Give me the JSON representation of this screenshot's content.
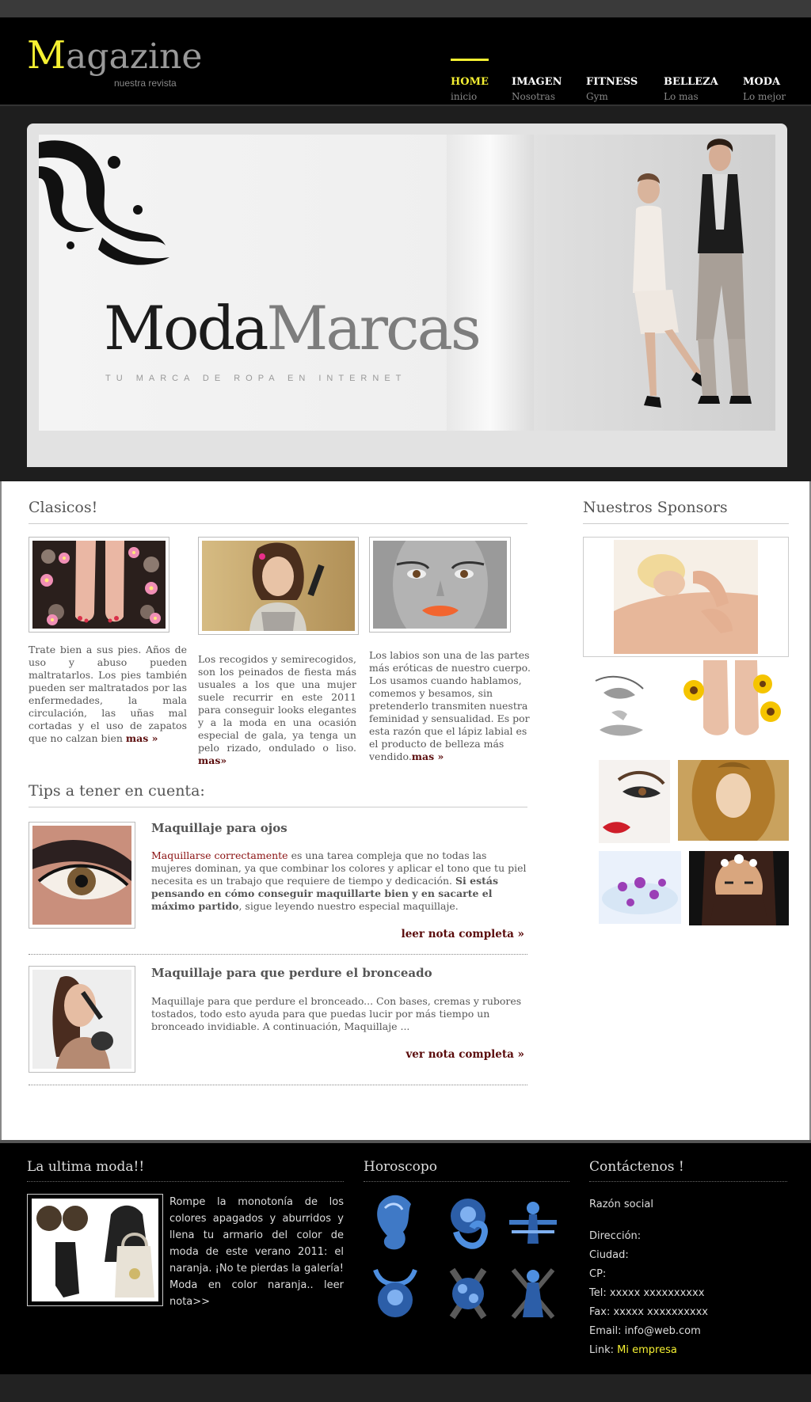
{
  "header": {
    "logo_first": "M",
    "logo_rest": "agazine",
    "logo_sub": "nuestra revista",
    "nav": [
      {
        "label": "HOME",
        "sub": "inicio",
        "active": true
      },
      {
        "label": "IMAGEN",
        "sub": "Nosotras"
      },
      {
        "label": "FITNESS",
        "sub": "Gym"
      },
      {
        "label": "BELLEZA",
        "sub": "Lo mas"
      },
      {
        "label": "MODA",
        "sub": "Lo mejor"
      }
    ]
  },
  "hero": {
    "brand_a": "Moda",
    "brand_b": "Marcas",
    "tagline": "TU MARCA DE ROPA EN INTERNET"
  },
  "clasicos": {
    "title": "Clasicos!",
    "items": [
      {
        "text": "Trate bien a sus pies. Años de uso y abuso pueden maltratarlos. Los pies también pueden ser maltratados por las enfermedades, la mala circulación, las uñas mal cortadas y el uso de zapatos que no calzan bien ",
        "more": "mas »"
      },
      {
        "text": "Los recogidos y semirecogidos, son los peinados de fiesta más usuales a los que una mujer suele recurrir en este 2011 para conseguir looks elegantes y a la moda en una ocasión especial de gala, ya tenga un pelo rizado, ondulado o liso. ",
        "more": "mas»"
      },
      {
        "text": "Los labios son una de las partes más eróticas de nuestro cuerpo. Los usamos cuando hablamos, comemos y besamos, sin pretenderlo transmiten nuestra feminidad y sensualidad. Es por esta razón que el lápiz labial es el producto de belleza más vendido.",
        "more": "mas »"
      }
    ]
  },
  "tips": {
    "title": "Tips a tener en cuenta:",
    "items": [
      {
        "title": "Maquillaje para ojos",
        "link_text": "Maquillarse correctamente",
        "body": " es una tarea compleja que no todas las mujeres dominan, ya que combinar los colores y aplicar el tono que tu piel necesita es un trabajo que requiere de tiempo y dedicación. ",
        "bold_text": "Si estás pensando en cómo conseguir maquillarte bien y en sacarte el máximo partido",
        "tail": ", sigue leyendo nuestro especial maquillaje.",
        "cta": "leer nota completa »"
      },
      {
        "title": "Maquillaje para que perdure el bronceado",
        "body": "Maquillaje para que perdure el bronceado... Con bases, cremas y rubores tostados, todo esto ayuda para que puedas lucir por más tiempo un bronceado invidiable. A continuación, Maquillaje ...",
        "cta": "ver nota completa »"
      }
    ]
  },
  "sponsors": {
    "title": "Nuestros Sponsors"
  },
  "footer": {
    "moda_title": "La ultima moda!!",
    "moda_text": "Rompe la monotonía de los colores apagados y aburridos y llena tu armario del color de moda de este verano 2011: el naranja. ¡No te pierdas la galería! Moda en color naranja.. leer nota>>",
    "horoscopo_title": "Horoscopo",
    "contact_title": "Contáctenos !",
    "contact": {
      "razon": "Razón social",
      "direccion": "Dirección:",
      "ciudad": "Ciudad:",
      "cp": "CP:",
      "tel": "Tel: xxxxx xxxxxxxxxx",
      "fax": "Fax: xxxxx xxxxxxxxxx",
      "email": "Email: info@web.com",
      "link_label": "Link: ",
      "link_value": "Mi empresa"
    }
  },
  "colors": {
    "accent": "#f5f032",
    "link_dark_red": "#5a0b0b",
    "header_bg": "#000000"
  }
}
